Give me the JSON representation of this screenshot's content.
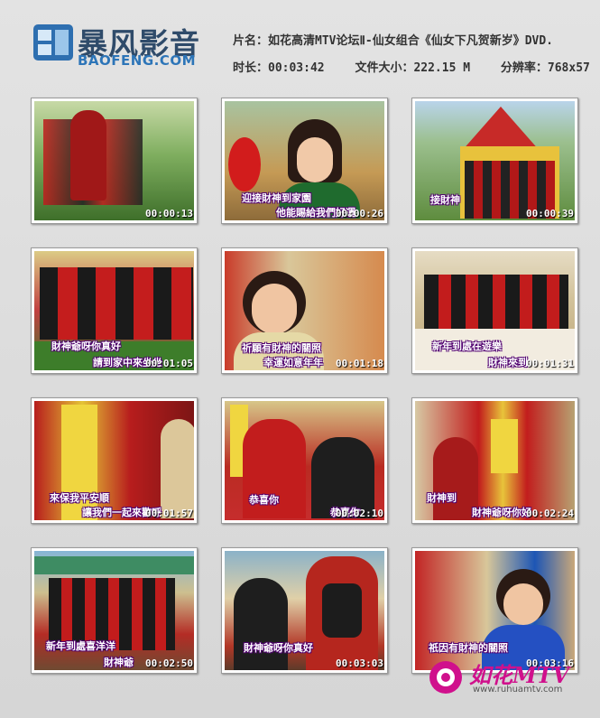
{
  "header": {
    "logo_cn": "暴风影音",
    "logo_en": "BAOFENG.COM",
    "title": "片名：如花高清MTV论坛Ⅱ-仙女组合《仙女下凡贺新岁》DVD.",
    "duration": "时长：00:03:42",
    "filesize": "文件大小：222.15 M",
    "resolution": "分辨率：768x57"
  },
  "thumbnails": [
    {
      "time": "00:00:13",
      "subtitle": "",
      "subtitle2": ""
    },
    {
      "time": "00:00:26",
      "subtitle": "迎接財神到家園",
      "subtitle2": "他能賜給我們好運"
    },
    {
      "time": "00:00:39",
      "subtitle": "接財神",
      "subtitle2": ""
    },
    {
      "time": "00:01:05",
      "subtitle": "財神爺呀你真好",
      "subtitle2": "請到家中來坐坐"
    },
    {
      "time": "00:01:18",
      "subtitle": "祈願有財神的關照",
      "subtitle2": "幸運如意年年"
    },
    {
      "time": "00:01:31",
      "subtitle": "新年到處在遊樂",
      "subtitle2": "財神來到"
    },
    {
      "time": "00:01:57",
      "subtitle": "來保我平安順",
      "subtitle2": "讓我們一起來歡呼"
    },
    {
      "time": "00:02:10",
      "subtitle": "恭喜你",
      "subtitle2": "恭喜你"
    },
    {
      "time": "00:02:24",
      "subtitle": "財神到",
      "subtitle2": "財神爺呀你好"
    },
    {
      "time": "00:02:50",
      "subtitle": "新年到處喜洋洋",
      "subtitle2": "財神爺"
    },
    {
      "time": "00:03:03",
      "subtitle": "財神爺呀你真好",
      "subtitle2": ""
    },
    {
      "time": "00:03:16",
      "subtitle": "祇因有財神的關照",
      "subtitle2": ""
    }
  ],
  "watermark": {
    "name": "如花MTV",
    "url": "www.ruhuamtv.com"
  }
}
